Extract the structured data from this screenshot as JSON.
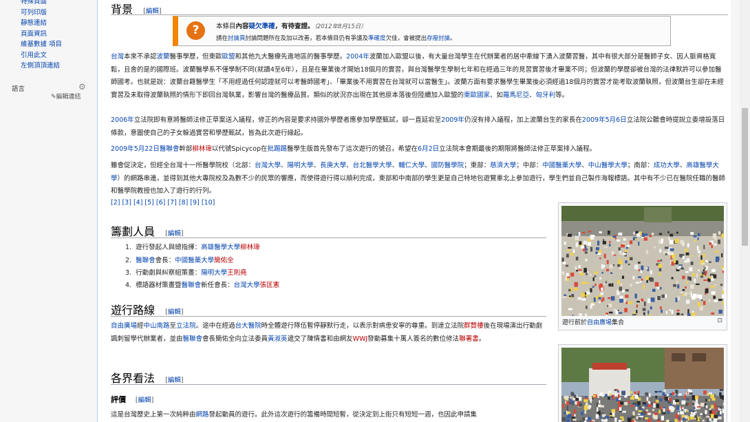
{
  "sidebar": {
    "tools": [
      "特殊頁面",
      "可列印版",
      "靜態連結",
      "頁面資訊",
      "維基數據 項目",
      "引用此文",
      "左側頂頂連結"
    ],
    "languages_heading": "語言",
    "edit_links": "✎編輯連結"
  },
  "section1": {
    "title": "背景",
    "edit": "編輯"
  },
  "ambox": {
    "icon": "?",
    "l1_a": "本條目",
    "l1_b": "內容",
    "l1_link": "疑欠準確",
    "l1_c": "，有待查證。",
    "l1_date": "（2012年8月15日）",
    "l2_a": "請在",
    "l2_link1": "討論頁",
    "l2_b": "討論問題所在及加以改善，若本條目仍有爭議及",
    "l2_link2": "準確度",
    "l2_c": "欠佳，會被提出",
    "l2_link3": "存廢討論",
    "l2_d": "。"
  },
  "paragraphs": {
    "p1": [
      {
        "t": "台灣",
        "l": 1
      },
      {
        "t": "本來不承認"
      },
      {
        "t": "波蘭",
        "l": 1
      },
      {
        "t": "醫事學歷，但東歐"
      },
      {
        "t": "歐盟",
        "l": 1
      },
      {
        "t": "和其他九大醫療先進地區的醫事學歷。"
      },
      {
        "t": "2004年",
        "l": 1
      },
      {
        "t": "波蘭加入歐盟以後，有大量台灣學生在代辦業者的居中牽線下湧入波蘭習醫，其中有很大部分是醫師子女、因人脈資格寬鬆，且舍的是的國際班。波蘭醫學系不僅學制不同(就讀4至6年），且是在畢業後才開始18個月的實習，與台灣醫學生學制七年和在經過三年的見習實習後才畢業不同；但波蘭的學歷卻被台灣的法律默許可以參加醫師國考。也就是說：波蘭台籍醫學生「不用經過任何認證就可以考醫師國考」、「畢業後不用實習在台灣就可以當醫生」。波蘭方面有要求醫學生畢業後必須經過18個月的實習才能考取波蘭執照，但波蘭台生卻在未經實習及未取得波蘭執照的情形下即回台灣執業，影響台灣的醫療品質。類似的狀況亦出現在其他原本落後但陸續加入歐盟的"
      },
      {
        "t": "東歐國家",
        "l": 1
      },
      {
        "t": "、如"
      },
      {
        "t": "羅馬尼亞",
        "l": 1
      },
      {
        "t": "、"
      },
      {
        "t": "匈牙利",
        "l": 1
      },
      {
        "t": "等。"
      }
    ],
    "p2": [
      {
        "t": "2006年",
        "l": 1
      },
      {
        "t": "立法院即有意將醫師法修正草案送入議程，修正的內容是要求持國外學歷者應參加學歷甄試，卻一直延宕至"
      },
      {
        "t": "2009年",
        "l": 1
      },
      {
        "t": "仍沒有排入議程，加上波蘭台生的家長在"
      },
      {
        "t": "2009年",
        "l": 1
      },
      {
        "t": "5月6日",
        "l": 1
      },
      {
        "t": "立法院公聽會時提說立委增設落日條款，意圖使自己的子女躲過實習和學歷甄試，皆為此次遊行緣起。"
      }
    ],
    "p3": [
      {
        "t": "2009年",
        "l": 1
      },
      {
        "t": "5月22日",
        "l": 1
      },
      {
        "t": "醫聯會",
        "l": 1
      },
      {
        "t": "幹部"
      },
      {
        "t": "柳林瑋",
        "r": 1
      },
      {
        "t": "以代號Spicycop在"
      },
      {
        "t": "批踢踢",
        "l": 1
      },
      {
        "t": "醫學生版首先發布了這次遊行的號召，希望在"
      },
      {
        "t": "6月2日",
        "l": 1
      },
      {
        "t": "立法院本會期最後的期限將醫師法修正草案排入議程。"
      }
    ],
    "p4": [
      {
        "t": "雖會促決定，但經全台灣十一所醫學院校（北部："
      },
      {
        "t": "台灣大學",
        "l": 1
      },
      {
        "t": "、"
      },
      {
        "t": "陽明大學",
        "l": 1
      },
      {
        "t": "、"
      },
      {
        "t": "長庚大學",
        "l": 1
      },
      {
        "t": "、"
      },
      {
        "t": "台北醫學大學",
        "l": 1
      },
      {
        "t": "、"
      },
      {
        "t": "輔仁大學",
        "l": 1
      },
      {
        "t": "、"
      },
      {
        "t": "國防醫學院",
        "l": 1
      },
      {
        "t": "；東部："
      },
      {
        "t": "慈濟大學",
        "l": 1
      },
      {
        "t": "；中部："
      },
      {
        "t": "中國醫藥大學",
        "l": 1
      },
      {
        "t": "、"
      },
      {
        "t": "中山醫學大學",
        "l": 1
      },
      {
        "t": "；南部："
      },
      {
        "t": "成功大學",
        "l": 1
      },
      {
        "t": "、"
      },
      {
        "t": "高雄醫學大學",
        "l": 1
      },
      {
        "t": "）的網路串連，並得到其他大專院校及為數不少的民眾的響應，而使得遊行得以順利完成，東部和中南部的學生更是自己特地包遊覽車北上參加遊行，學生們並自己製作海報標語。其中有不少已在醫院任職的醫師和醫學院教授也加入了遊行的行列。"
      }
    ],
    "refs": "[2] [3] [4] [5] [6] [7] [8] [9] [10]"
  },
  "section2": {
    "title": "籌劃人員",
    "edit": "編輯",
    "items": [
      [
        {
          "t": "1."
        },
        {
          "t": "遊行發起人與總指揮："
        },
        {
          "t": "高雄醫學大學",
          "l": 1
        },
        {
          "t": "柳林瑋",
          "r": 1
        }
      ],
      [
        {
          "t": "2."
        },
        {
          "t": "醫聯會",
          "l": 1
        },
        {
          "t": "會長："
        },
        {
          "t": "中國醫藥大學",
          "l": 1
        },
        {
          "t": "簡佑全",
          "r": 1
        }
      ],
      [
        {
          "t": "3."
        },
        {
          "t": "行動劇與糾察組策畫："
        },
        {
          "t": "陽明大學",
          "l": 1
        },
        {
          "t": "王則堯",
          "r": 1
        }
      ],
      [
        {
          "t": "4."
        },
        {
          "t": "標語器材策畫暨"
        },
        {
          "t": "醫聯會",
          "l": 1
        },
        {
          "t": "新任會長："
        },
        {
          "t": "台灣大學",
          "l": 1
        },
        {
          "t": "張匡憲",
          "r": 1
        }
      ]
    ]
  },
  "section3": {
    "title": "遊行路線",
    "edit": "編輯",
    "para": [
      {
        "t": "自由廣場",
        "l": 1
      },
      {
        "t": "經"
      },
      {
        "t": "中山南路",
        "l": 1
      },
      {
        "t": "至"
      },
      {
        "t": "立法院",
        "l": 1
      },
      {
        "t": "。途中在經過"
      },
      {
        "t": "台大醫院",
        "l": 1
      },
      {
        "t": "時全體遊行隊伍暫停靜默行走，以表示對病患安寧的尊重。到達立法院"
      },
      {
        "t": "群賢樓",
        "r": 1
      },
      {
        "t": "後在現場演出行動劇諷刺留學代辦業者，並由"
      },
      {
        "t": "醫聯會",
        "l": 1
      },
      {
        "t": "會長簡佑全向立法委員"
      },
      {
        "t": "黃淑英",
        "l": 1
      },
      {
        "t": "遞交了陳情書和由網友"
      },
      {
        "t": "WWJ",
        "r": 1
      },
      {
        "t": "發動募集十萬人簽名的數位修法"
      },
      {
        "t": "聯署書",
        "r": 1
      },
      {
        "t": "。"
      }
    ]
  },
  "section4": {
    "title": "各界看法",
    "edit": "編輯",
    "sub": {
      "title": "評價",
      "edit": "編輯"
    },
    "para": [
      {
        "t": "這是台灣歷史上第一次純粹由"
      },
      {
        "t": "網路",
        "l": 1
      },
      {
        "t": "發起動員的遊行。此外這次遊行的籌備時間短暫，從決定到上街只有短短一週，也因此申請集"
      }
    ]
  },
  "thumb1": {
    "cap_a": "遊行前於",
    "cap_link": "自由廣場",
    "cap_b": "集合",
    "mag": "⊡"
  },
  "thumb2": {}
}
